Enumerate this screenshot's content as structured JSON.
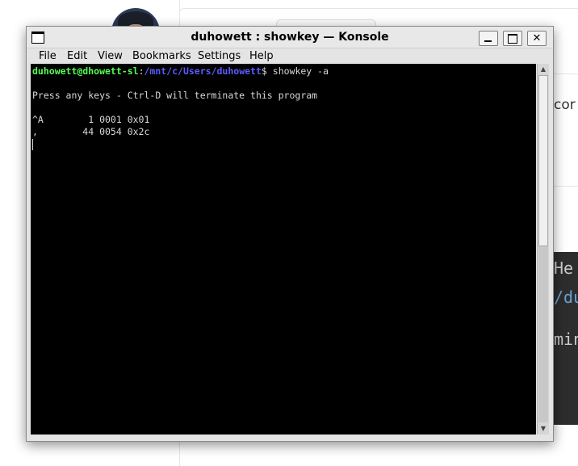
{
  "background": {
    "text_fragment": "cor",
    "code_lines": [
      "He",
      "/du",
      "min"
    ]
  },
  "window": {
    "title": "duhowett : showkey — Konsole",
    "buttons": {
      "minimize": "minimize",
      "maximize": "maximize",
      "close": "✕"
    }
  },
  "menu": [
    "File",
    "Edit",
    "View",
    "Bookmarks",
    "Settings",
    "Help"
  ],
  "terminal": {
    "prompt_user": "duhowett@dhowett-sl",
    "prompt_sep": ":",
    "prompt_path": "/mnt/c/Users/duhowett",
    "prompt_symbol": "$ ",
    "command": "showkey -a",
    "lines": [
      "Press any keys - Ctrl-D will terminate this program",
      "^A        1 0001 0x01",
      ",        44 0054 0x2c"
    ]
  },
  "scrollbar": {
    "up_arrow": "▲",
    "down_arrow": "▼"
  }
}
